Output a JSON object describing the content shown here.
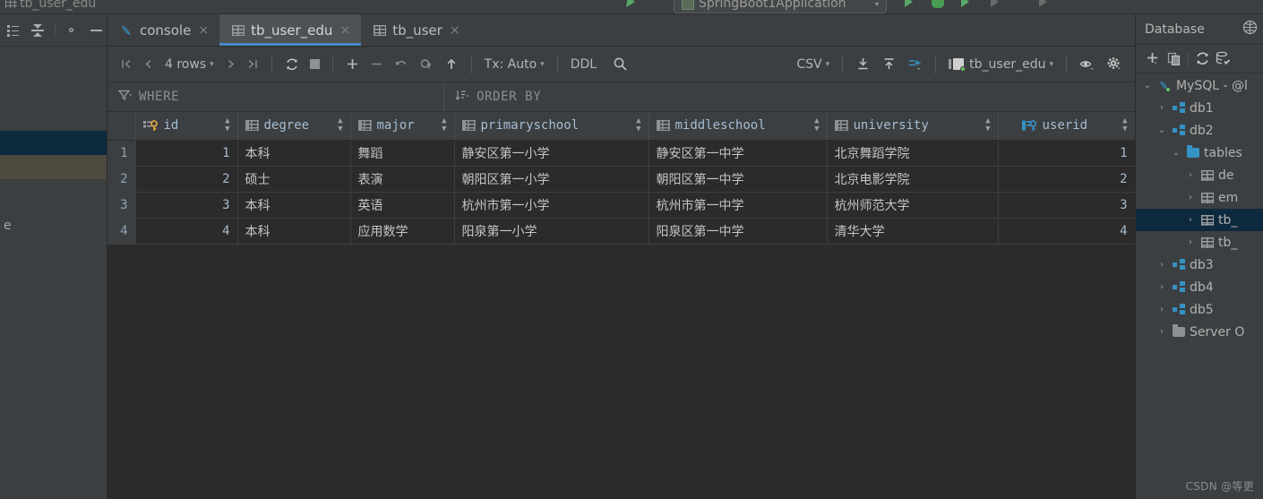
{
  "topbar": {
    "cut_tab_label": "tb_user_edu",
    "run_config": "SpringBoot1Application",
    "run_caret": "▾"
  },
  "left_panel": {
    "toolbar": {
      "tree_icon": "tree-view-icon",
      "collapse_icon": "collapse-all-icon",
      "settings_icon": "gear-icon",
      "hide_icon": "minimize-icon"
    },
    "fragment_text": "e"
  },
  "editor_tabs": [
    {
      "label": "console",
      "icon": "dolphin-icon",
      "active": false,
      "close": "×"
    },
    {
      "label": "tb_user_edu",
      "icon": "table-icon",
      "active": true,
      "close": "×"
    },
    {
      "label": "tb_user",
      "icon": "table-icon",
      "active": false,
      "close": "×"
    }
  ],
  "grid_toolbar": {
    "first_page": "first-page-icon",
    "prev_page": "prev-page-icon",
    "rows_label": "4 rows",
    "rows_caret": "▾",
    "next_page": "next-page-icon",
    "last_page": "last-page-icon",
    "reload": "reload-icon",
    "stop": "stop-icon",
    "add_row": "+",
    "delete_row": "−",
    "revert": "revert-icon",
    "revert_selected": "revert-selected-icon",
    "submit": "submit-icon",
    "tx_label": "Tx: Auto",
    "tx_caret": "▾",
    "ddl_label": "DDL",
    "search": "search-icon",
    "format_label": "CSV",
    "format_caret": "▾",
    "export_to_file": "download-icon",
    "import_from_file": "upload-icon",
    "compare": "compare-icon",
    "table_chooser": "tb_user_edu",
    "table_chooser_caret": "▾",
    "view_options": "eye-icon",
    "settings": "gear-icon"
  },
  "filter_bar": {
    "where_icon": "filter-icon",
    "where_label": "WHERE",
    "order_icon": "sort-icon",
    "order_label": "ORDER BY"
  },
  "grid": {
    "columns": [
      {
        "name": "id",
        "icon": "primary-key-icon",
        "sortable": true,
        "type": "number"
      },
      {
        "name": "degree",
        "icon": "column-icon",
        "sortable": true,
        "type": "text"
      },
      {
        "name": "major",
        "icon": "column-icon",
        "sortable": true,
        "type": "text"
      },
      {
        "name": "primaryschool",
        "icon": "column-icon",
        "sortable": true,
        "type": "text"
      },
      {
        "name": "middleschool",
        "icon": "column-icon",
        "sortable": true,
        "type": "text"
      },
      {
        "name": "university",
        "icon": "column-icon",
        "sortable": true,
        "type": "text"
      },
      {
        "name": "userid",
        "icon": "foreign-key-icon",
        "sortable": true,
        "type": "number"
      }
    ],
    "rows": [
      {
        "n": "1",
        "id": "1",
        "degree": "本科",
        "major": "舞蹈",
        "primaryschool": "静安区第一小学",
        "middleschool": "静安区第一中学",
        "university": "北京舞蹈学院",
        "userid": "1"
      },
      {
        "n": "2",
        "id": "2",
        "degree": "硕士",
        "major": "表演",
        "primaryschool": "朝阳区第一小学",
        "middleschool": "朝阳区第一中学",
        "university": "北京电影学院",
        "userid": "2"
      },
      {
        "n": "3",
        "id": "3",
        "degree": "本科",
        "major": "英语",
        "primaryschool": "杭州市第一小学",
        "middleschool": "杭州市第一中学",
        "university": "杭州师范大学",
        "userid": "3"
      },
      {
        "n": "4",
        "id": "4",
        "degree": "本科",
        "major": "应用数学",
        "primaryschool": "阳泉第一小学",
        "middleschool": "阳泉区第一中学",
        "university": "清华大学",
        "userid": "4"
      }
    ]
  },
  "database_panel": {
    "title": "Database",
    "header_icon": "database-group-icon",
    "toolbar": {
      "add": "+",
      "add_caret": "▾",
      "copy": "copy-icon",
      "refresh": "refresh-icon",
      "data_source_properties": "db-wrench-icon"
    },
    "tree": [
      {
        "label": "MySQL - @l",
        "depth": 0,
        "twisty": "⌄",
        "icon": "mysql-dolphin-icon",
        "selected": false
      },
      {
        "label": "db1",
        "depth": 1,
        "twisty": "›",
        "icon": "schema-icon",
        "selected": false
      },
      {
        "label": "db2",
        "depth": 1,
        "twisty": "⌄",
        "icon": "schema-icon",
        "selected": false
      },
      {
        "label": "tables",
        "depth": 2,
        "twisty": "⌄",
        "icon": "folder-icon",
        "selected": false
      },
      {
        "label": "de",
        "depth": 3,
        "twisty": "›",
        "icon": "table-icon",
        "selected": false
      },
      {
        "label": "em",
        "depth": 3,
        "twisty": "›",
        "icon": "table-icon",
        "selected": false
      },
      {
        "label": "tb_",
        "depth": 3,
        "twisty": "›",
        "icon": "table-icon",
        "selected": true
      },
      {
        "label": "tb_",
        "depth": 3,
        "twisty": "›",
        "icon": "table-icon",
        "selected": false
      },
      {
        "label": "db3",
        "depth": 1,
        "twisty": "›",
        "icon": "schema-icon",
        "selected": false
      },
      {
        "label": "db4",
        "depth": 1,
        "twisty": "›",
        "icon": "schema-icon",
        "selected": false
      },
      {
        "label": "db5",
        "depth": 1,
        "twisty": "›",
        "icon": "schema-icon",
        "selected": false
      },
      {
        "label": "Server O",
        "depth": 1,
        "twisty": "›",
        "icon": "folder-grey-icon",
        "selected": false
      }
    ]
  },
  "watermark": "CSDN @等更",
  "colors": {
    "bg_chrome": "#3c3f41",
    "bg_grid": "#2b2b2b",
    "accent_blue": "#4a88c7",
    "selection_blue": "#0d293e",
    "hover_olive": "#4e4a3f",
    "icon_blue": "#3592c4",
    "green_dot": "#62c462",
    "text_primary": "#bbbbbb",
    "header_text": "#a4bdd4"
  }
}
